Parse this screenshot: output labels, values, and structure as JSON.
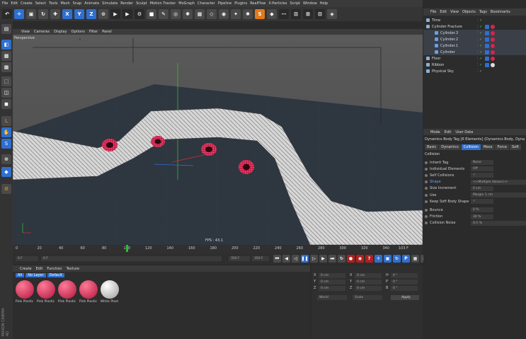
{
  "menubar": [
    "File",
    "Edit",
    "Create",
    "Select",
    "Tools",
    "Mesh",
    "Snap",
    "Animate",
    "Simulate",
    "Render",
    "Sculpt",
    "Motion Tracker",
    "MoGraph",
    "Character",
    "Pipeline",
    "Plugins",
    "RealFlow",
    "X-Particles",
    "Script",
    "Window",
    "Help"
  ],
  "viewport": {
    "menu": [
      "View",
      "Cameras",
      "Display",
      "Options",
      "Filter",
      "Panel"
    ],
    "label": "Perspective",
    "fps": "FPS : 43.1"
  },
  "timeline": {
    "ticks": [
      "0",
      "20",
      "40",
      "60",
      "80",
      "100",
      "120",
      "140",
      "160",
      "180",
      "200",
      "220",
      "240",
      "260",
      "280",
      "300",
      "320",
      "340"
    ],
    "current_frame_marker": "101",
    "end_label": "103 F"
  },
  "transport": {
    "start_field": "0 F",
    "start_field2": "0 F",
    "end_field": "350 F",
    "end_field2": "350 F"
  },
  "materials": {
    "menu": [
      "Create",
      "Edit",
      "Function",
      "Texture"
    ],
    "filters": [
      "All",
      "No Layer",
      "Default"
    ],
    "items": [
      {
        "name": "Pink Plastic"
      },
      {
        "name": "Pink Plastic"
      },
      {
        "name": "Pink Plastic"
      },
      {
        "name": "Pink Plastic"
      },
      {
        "name": "White Plast"
      }
    ]
  },
  "coords": {
    "rows": [
      {
        "a": "X",
        "av": "0 cm",
        "b": "X",
        "bv": "0 cm",
        "c": "H",
        "cv": "0 °"
      },
      {
        "a": "Y",
        "av": "0 cm",
        "b": "Y",
        "bv": "0 cm",
        "c": "P",
        "cv": "0 °"
      },
      {
        "a": "Z",
        "av": "0 cm",
        "b": "Z",
        "bv": "0 cm",
        "c": "B",
        "cv": "0 °"
      }
    ],
    "mode": "World",
    "scale": "Scale",
    "apply": "Apply"
  },
  "objmgr": {
    "menu": [
      "File",
      "Edit",
      "View",
      "Objects",
      "Tags",
      "Bookmarks"
    ],
    "objects": [
      {
        "name": "Time",
        "indent": 0
      },
      {
        "name": "Cylinder Fracture",
        "indent": 0
      },
      {
        "name": "Cylinder.3",
        "indent": 1
      },
      {
        "name": "Cylinder.2",
        "indent": 1
      },
      {
        "name": "Cylinder.1",
        "indent": 1
      },
      {
        "name": "Cylinder",
        "indent": 1
      },
      {
        "name": "Floor",
        "indent": 0
      },
      {
        "name": "Ribbon",
        "indent": 0
      },
      {
        "name": "Physical Sky",
        "indent": 0
      }
    ]
  },
  "attrmgr": {
    "menu": [
      "Mode",
      "Edit",
      "User Data"
    ],
    "title": "Dynamics Body Tag [6 Elements] (Dynamics Body, Dyna",
    "tabs": [
      "Basic",
      "Dynamics",
      "Collision",
      "Mass",
      "Force",
      "Soft"
    ],
    "active_tab": "Collision",
    "section": "Collision",
    "rows": [
      {
        "label": "Inherit Tag",
        "value": "None"
      },
      {
        "label": "Individual Elements",
        "value": "Off"
      },
      {
        "label": "Self Collisions",
        "value": "✓"
      },
      {
        "label": "Shape",
        "value": "<<Multiple Values>>"
      },
      {
        "label": "Size Increment",
        "value": "0 cm"
      },
      {
        "label": "Use",
        "value": "Margin  1 cm"
      },
      {
        "label": "Keep Soft Body Shape",
        "value": "✓"
      },
      {
        "label": "Bounce",
        "value": "0 %"
      },
      {
        "label": "Friction",
        "value": "30 %"
      },
      {
        "label": "Collision Noise",
        "value": "0.5 %"
      }
    ]
  },
  "brand": "MAXON CINEMA 4D",
  "colors": {
    "accent": "#2f6fcf",
    "pink": "#d8244a",
    "panel": "#2b2b2b"
  }
}
